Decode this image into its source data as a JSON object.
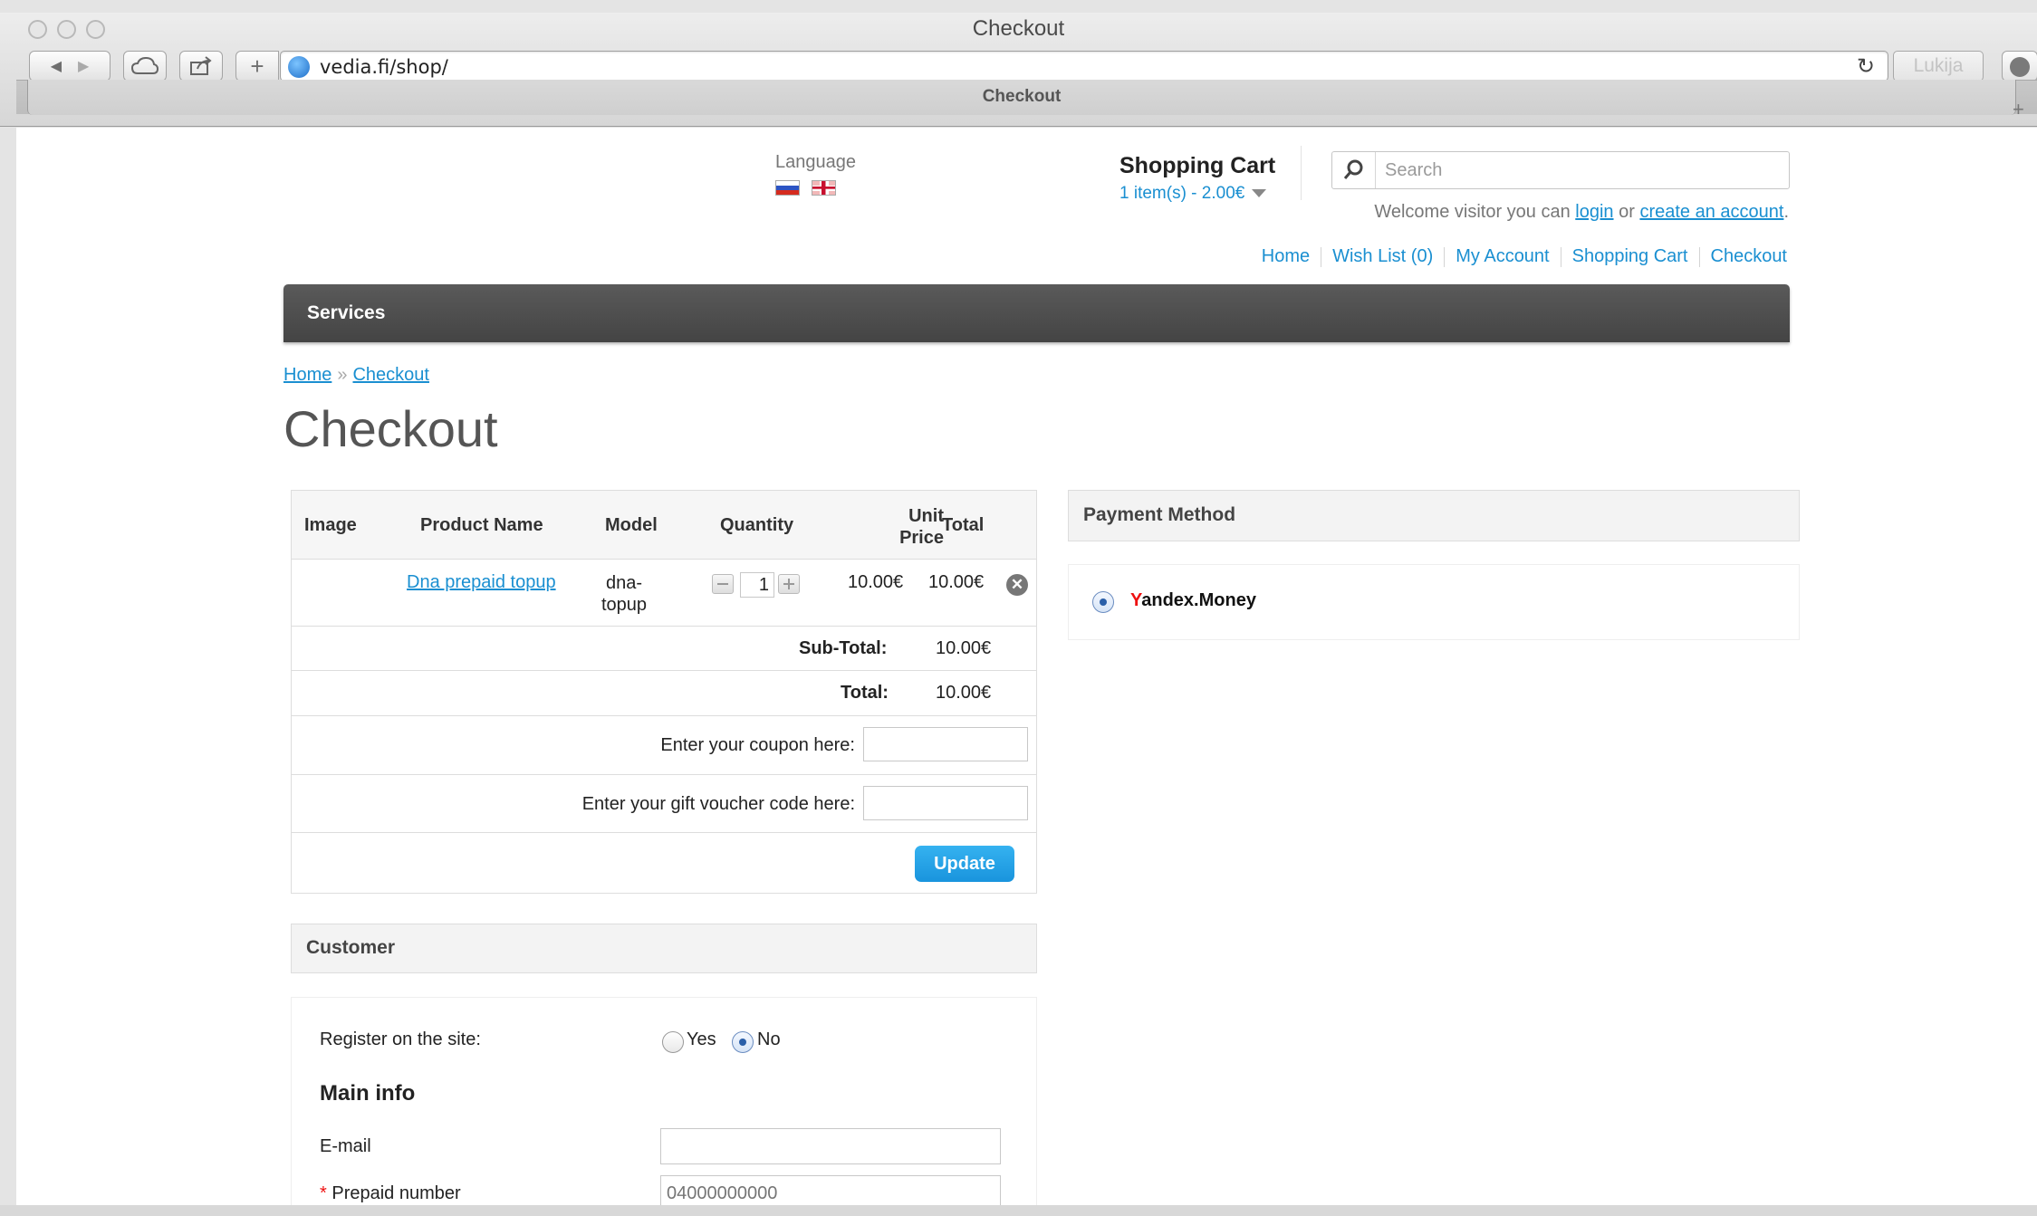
{
  "browser": {
    "window_title": "Checkout",
    "url": "vedia.fi/shop/",
    "reader_label": "Lukija",
    "tab_title": "Checkout"
  },
  "header": {
    "language_label": "Language",
    "cart_title": "Shopping Cart",
    "cart_summary": "1 item(s) - 2.00€",
    "search_placeholder": "Search",
    "welcome_prefix": "Welcome visitor you can ",
    "login_link": "login",
    "welcome_or": " or ",
    "create_account_link": "create an account",
    "welcome_suffix": ".",
    "links": [
      "Home",
      "Wish List (0)",
      "My Account",
      "Shopping Cart",
      "Checkout"
    ]
  },
  "menu": {
    "services": "Services"
  },
  "breadcrumb": [
    "Home",
    "Checkout"
  ],
  "page_title": "Checkout",
  "cart_table": {
    "headers": {
      "image": "Image",
      "product_name": "Product Name",
      "model": "Model",
      "quantity": "Quantity",
      "unit_price_line1": "Unit",
      "unit_price_line2": "Price",
      "total": "Total"
    },
    "item": {
      "product_name": "Dna prepaid topup",
      "model_line1": "dna-",
      "model_line2": "topup",
      "quantity": "1",
      "unit_price": "10.00€",
      "total": "10.00€"
    },
    "subtotal_label": "Sub-Total:",
    "subtotal_value": "10.00€",
    "total_label": "Total:",
    "total_value": "10.00€",
    "coupon_label": "Enter your coupon here:",
    "voucher_label": "Enter your gift voucher code here:",
    "update_label": "Update"
  },
  "customer": {
    "title": "Customer",
    "register_label": "Register on the site:",
    "yes_label": "Yes",
    "no_label": "No",
    "register_selected": "No",
    "main_info_title": "Main info",
    "email_label": "E-mail",
    "prepaid_required": "*",
    "prepaid_label": " Prepaid number",
    "prepaid_placeholder": "04000000000"
  },
  "payment": {
    "title": "Payment Method",
    "option_first_letter": "Y",
    "option_rest": "andex.Money",
    "selected": true
  }
}
